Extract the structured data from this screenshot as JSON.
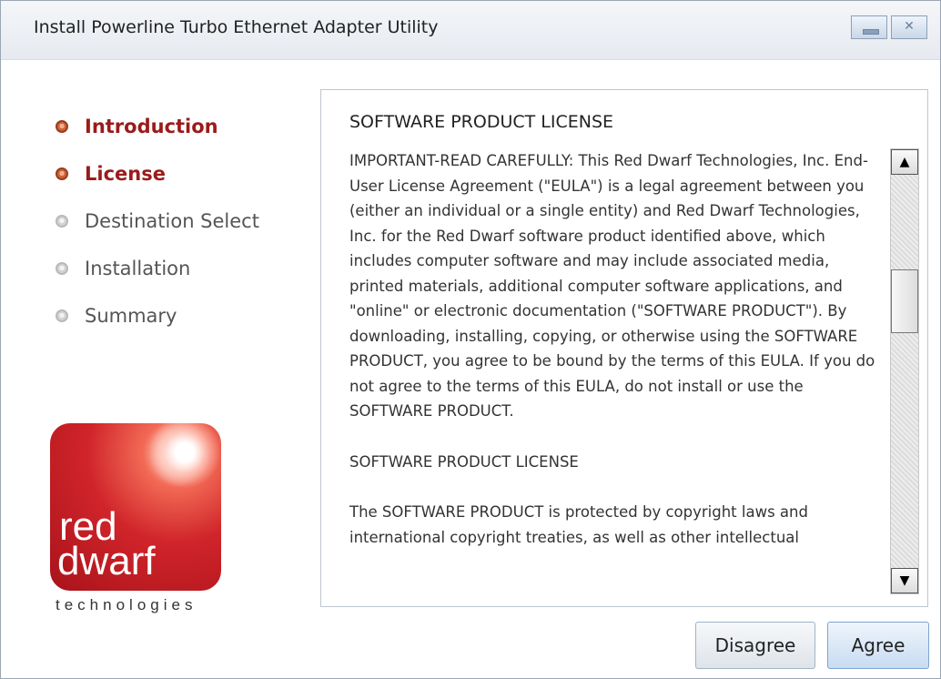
{
  "window": {
    "title": "Install Powerline Turbo Ethernet Adapter Utility",
    "minimize_icon": "minimize-icon",
    "close_icon": "close-icon"
  },
  "steps": [
    {
      "label": "Introduction",
      "state": "active"
    },
    {
      "label": "License",
      "state": "active"
    },
    {
      "label": "Destination Select",
      "state": "inactive"
    },
    {
      "label": "Installation",
      "state": "inactive"
    },
    {
      "label": "Summary",
      "state": "inactive"
    }
  ],
  "logo": {
    "line1": "red",
    "line2": "dwarf",
    "subtitle": "technologies"
  },
  "license": {
    "title": "SOFTWARE PRODUCT LICENSE",
    "paragraph1": "IMPORTANT-READ CAREFULLY: This Red Dwarf Technologies, Inc. End-User License Agreement (\"EULA\") is a legal agreement between you (either an individual or a single entity) and Red Dwarf Technologies, Inc. for the Red Dwarf software product identified above, which includes computer software and may include associated media, printed materials, additional computer software applications, and \"online\" or electronic documentation (\"SOFTWARE PRODUCT\").  By downloading, installing, copying, or otherwise using the SOFTWARE PRODUCT, you agree to be bound by the terms of this EULA.  If you do not agree to the terms of this EULA, do not install or use the SOFTWARE PRODUCT.",
    "heading2": "SOFTWARE PRODUCT LICENSE",
    "paragraph2": "The SOFTWARE PRODUCT is protected by copyright laws and international copyright treaties, as well as other intellectual"
  },
  "scrollbar": {
    "up_icon": "scroll-up-arrow-icon",
    "down_icon": "scroll-down-arrow-icon"
  },
  "buttons": {
    "disagree": "Disagree",
    "agree": "Agree"
  },
  "colors": {
    "active_step": "#9b1b1b",
    "inactive_step": "#555555",
    "brand_red": "#d0242a"
  }
}
